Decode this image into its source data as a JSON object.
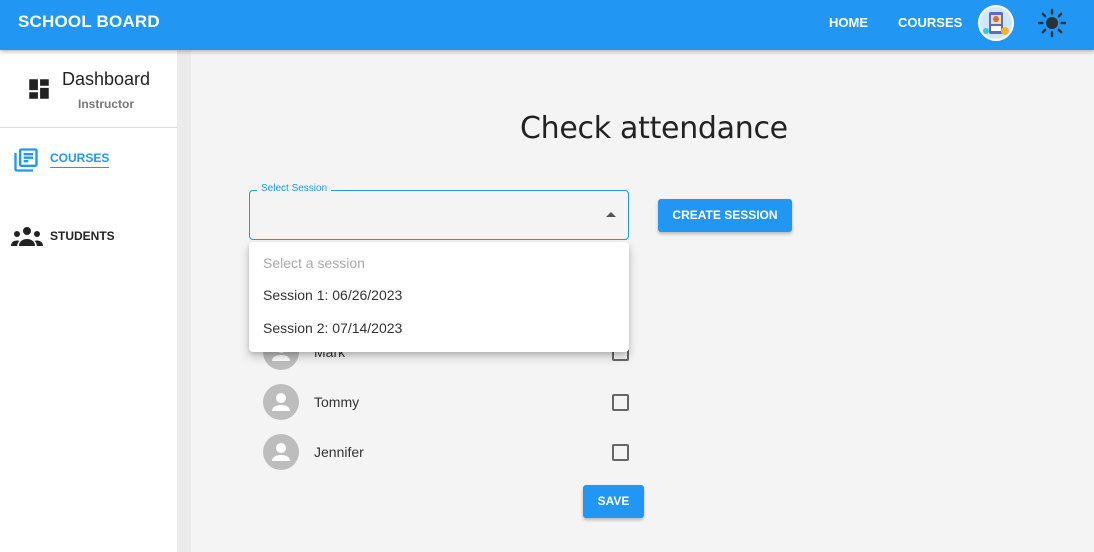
{
  "appbar": {
    "brand": "SCHOOL BOARD",
    "nav": {
      "home": "HOME",
      "courses": "COURSES"
    },
    "colors": {
      "primary": "#2196f3"
    }
  },
  "sidebar": {
    "dashboard_title": "Dashboard",
    "dashboard_role": "Instructor",
    "items": [
      {
        "label": "COURSES",
        "icon": "library-books-icon",
        "active": true
      },
      {
        "label": "STUDENTS",
        "icon": "people-icon",
        "active": false
      }
    ]
  },
  "main": {
    "title": "Check attendance",
    "select": {
      "label": "Select Session",
      "value": "",
      "options": [
        "Select a session",
        "Session 1: 06/26/2023",
        "Session 2: 07/14/2023"
      ]
    },
    "create_session_label": "CREATE SESSION",
    "students": [
      {
        "name": "Mark",
        "checked": false
      },
      {
        "name": "Tommy",
        "checked": false
      },
      {
        "name": "Jennifer",
        "checked": false
      }
    ],
    "save_label": "SAVE"
  }
}
